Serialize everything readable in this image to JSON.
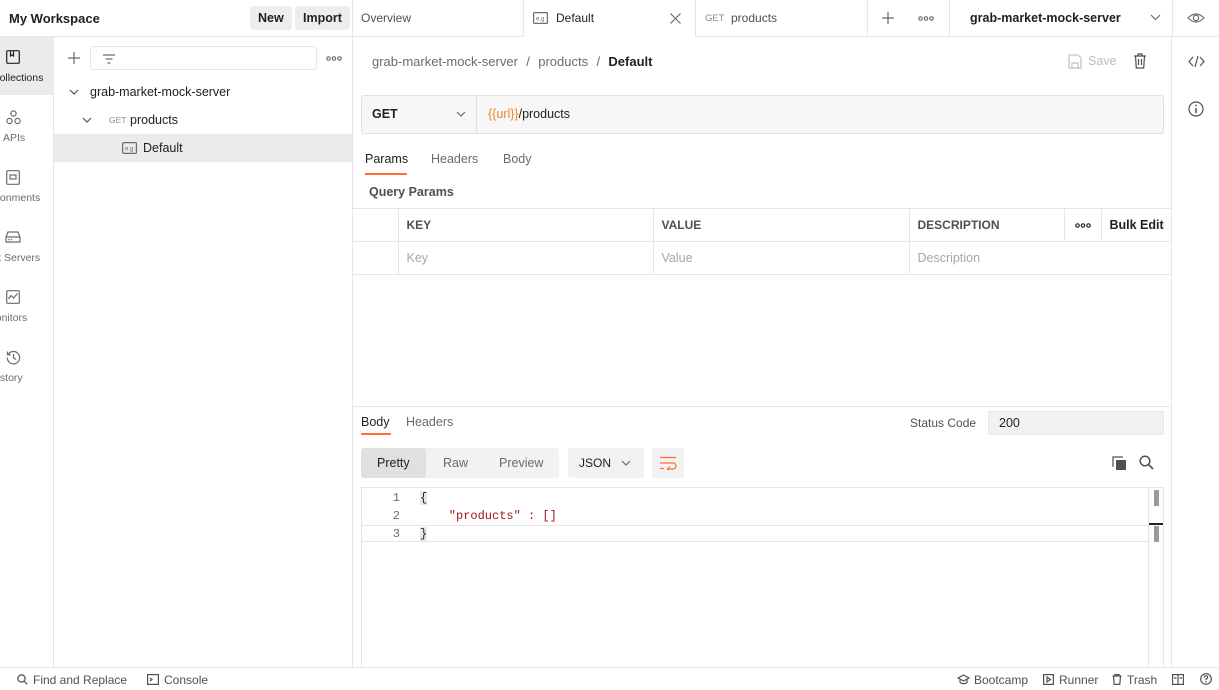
{
  "workspace": {
    "title": "My Workspace",
    "new_label": "New",
    "import_label": "Import"
  },
  "tabs": [
    {
      "label": "Overview"
    },
    {
      "label": "Default"
    },
    {
      "method": "GET",
      "label": "products"
    }
  ],
  "environment": {
    "selected": "grab-market-mock-server"
  },
  "rail": [
    {
      "label": "Collections",
      "icon": "collections-icon"
    },
    {
      "label": "APIs",
      "icon": "apis-icon"
    },
    {
      "label": "Environments",
      "icon": "environments-icon"
    },
    {
      "label": "Mock Servers",
      "icon": "mock-servers-icon"
    },
    {
      "label": "Monitors",
      "icon": "monitors-icon"
    },
    {
      "label": "History",
      "icon": "history-icon"
    }
  ],
  "tree": {
    "collection": "grab-market-mock-server",
    "request": {
      "method": "GET",
      "name": "products"
    },
    "example": "Default"
  },
  "breadcrumb": {
    "collection": "grab-market-mock-server",
    "sep": "/",
    "request": "products",
    "current": "Default"
  },
  "toolbar": {
    "save_label": "Save"
  },
  "request": {
    "method": "GET",
    "url_var": "{{url}}",
    "url_path": "/products"
  },
  "param_tabs": [
    "Params",
    "Headers",
    "Body"
  ],
  "query_params": {
    "title": "Query Params",
    "headers": {
      "key": "KEY",
      "value": "VALUE",
      "description": "DESCRIPTION",
      "bulk": "Bulk Edit"
    },
    "placeholders": {
      "key": "Key",
      "value": "Value",
      "description": "Description"
    }
  },
  "response": {
    "tabs": [
      "Body",
      "Headers"
    ],
    "status_label": "Status Code",
    "status_value": "200",
    "views": [
      "Pretty",
      "Raw",
      "Preview"
    ],
    "format": "JSON",
    "lines": [
      "{",
      "    \"products\" : []",
      "}"
    ],
    "line_numbers": [
      "1",
      "2",
      "3"
    ]
  },
  "footer": {
    "find_replace": "Find and Replace",
    "console": "Console",
    "bootcamp": "Bootcamp",
    "runner": "Runner",
    "trash": "Trash"
  },
  "colors": {
    "accent": "#ff6c37",
    "variable": "#e5892b",
    "string": "#a31515"
  }
}
